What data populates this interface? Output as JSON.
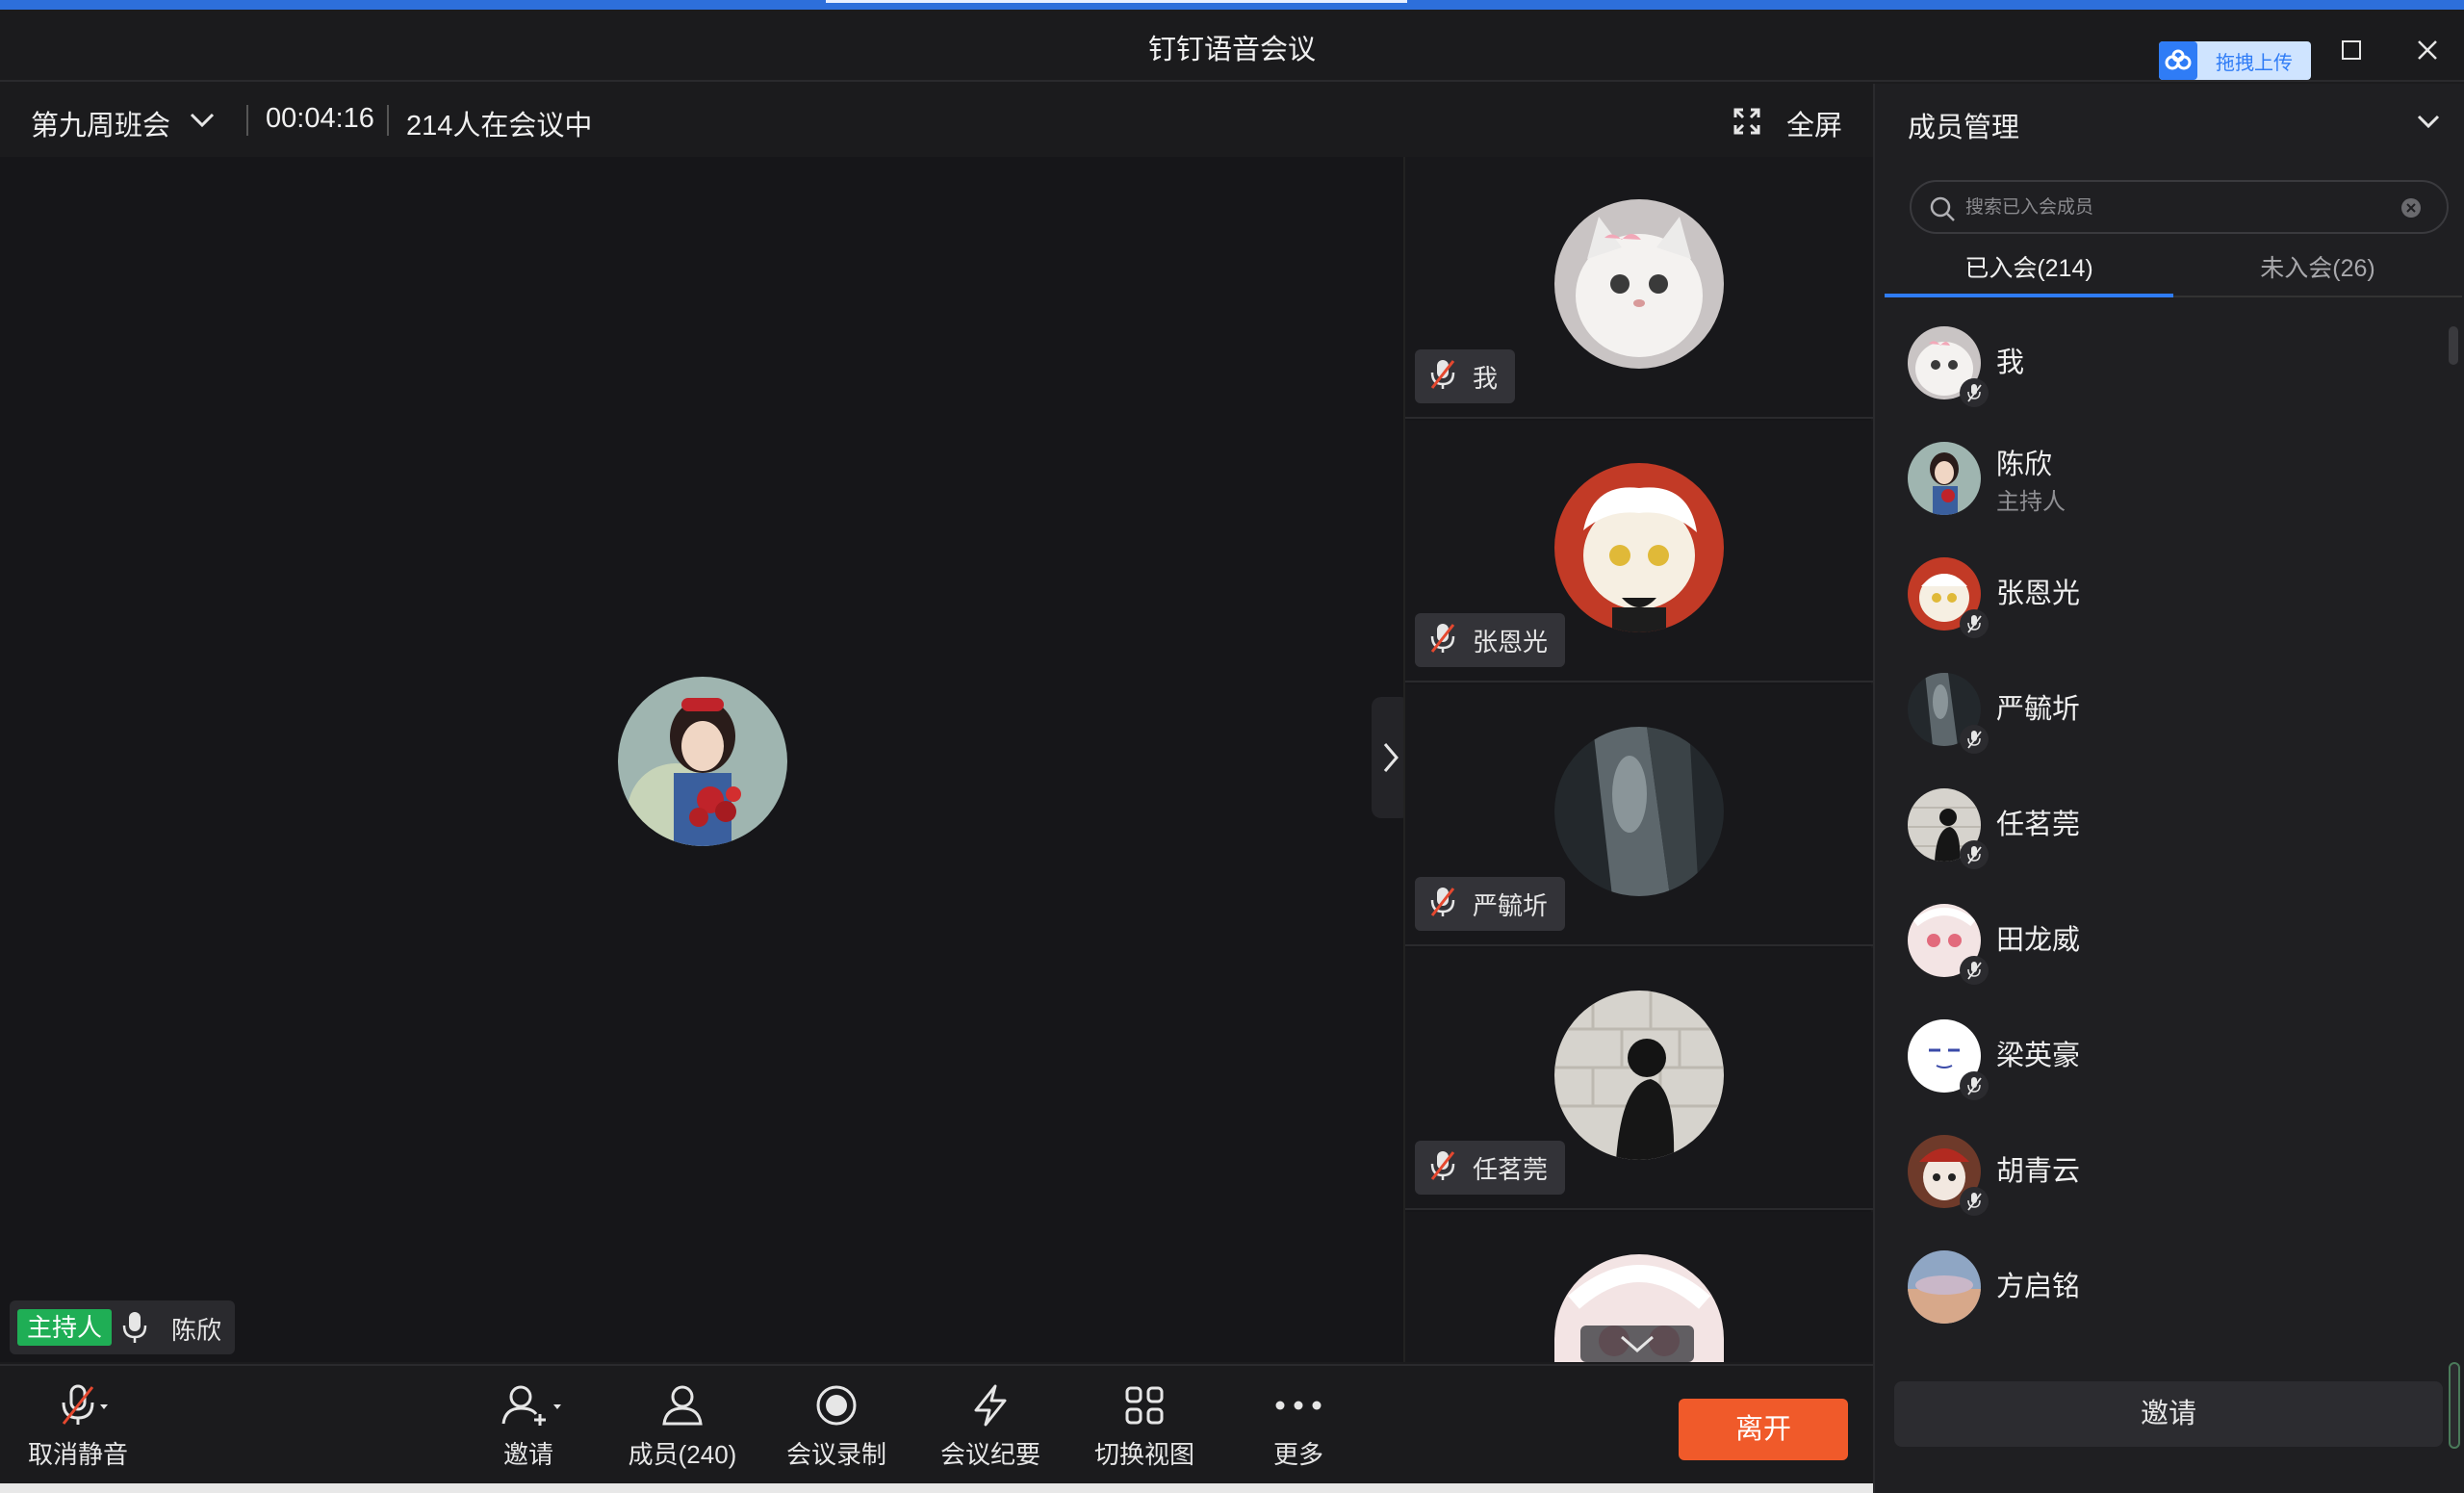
{
  "window": {
    "title": "钉钉语音会议",
    "upload_label": "拖拽上传"
  },
  "meeting": {
    "name": "第九周班会",
    "elapsed": "00:04:16",
    "attendance": "214人在会议中",
    "fullscreen_label": "全屏"
  },
  "stage": {
    "speaker_badge": "主持人",
    "speaker_name": "陈欣"
  },
  "tiles": [
    {
      "name": "我"
    },
    {
      "name": "张恩光"
    },
    {
      "name": "严毓圻"
    },
    {
      "name": "任茗莞"
    }
  ],
  "toolbar": {
    "unmute": "取消静音",
    "invite": "邀请",
    "members": "成员(240)",
    "record": "会议录制",
    "minutes": "会议纪要",
    "switch_view": "切换视图",
    "more": "更多",
    "leave": "离开"
  },
  "panel": {
    "title": "成员管理",
    "search_placeholder": "搜索已入会成员",
    "tab_joined": "已入会(214)",
    "tab_not_joined": "未入会(26)",
    "invite": "邀请",
    "members": [
      {
        "name": "我",
        "role": ""
      },
      {
        "name": "陈欣",
        "role": "主持人"
      },
      {
        "name": "张恩光",
        "role": ""
      },
      {
        "name": "严毓圻",
        "role": ""
      },
      {
        "name": "任茗莞",
        "role": ""
      },
      {
        "name": "田龙威",
        "role": ""
      },
      {
        "name": "梁英豪",
        "role": ""
      },
      {
        "name": "胡青云",
        "role": ""
      },
      {
        "name": "方启铭",
        "role": ""
      }
    ]
  },
  "colors": {
    "accent": "#2f7cf6",
    "leave": "#f05a2a",
    "host_badge": "#1fae55",
    "muted_red": "#e5482f"
  }
}
